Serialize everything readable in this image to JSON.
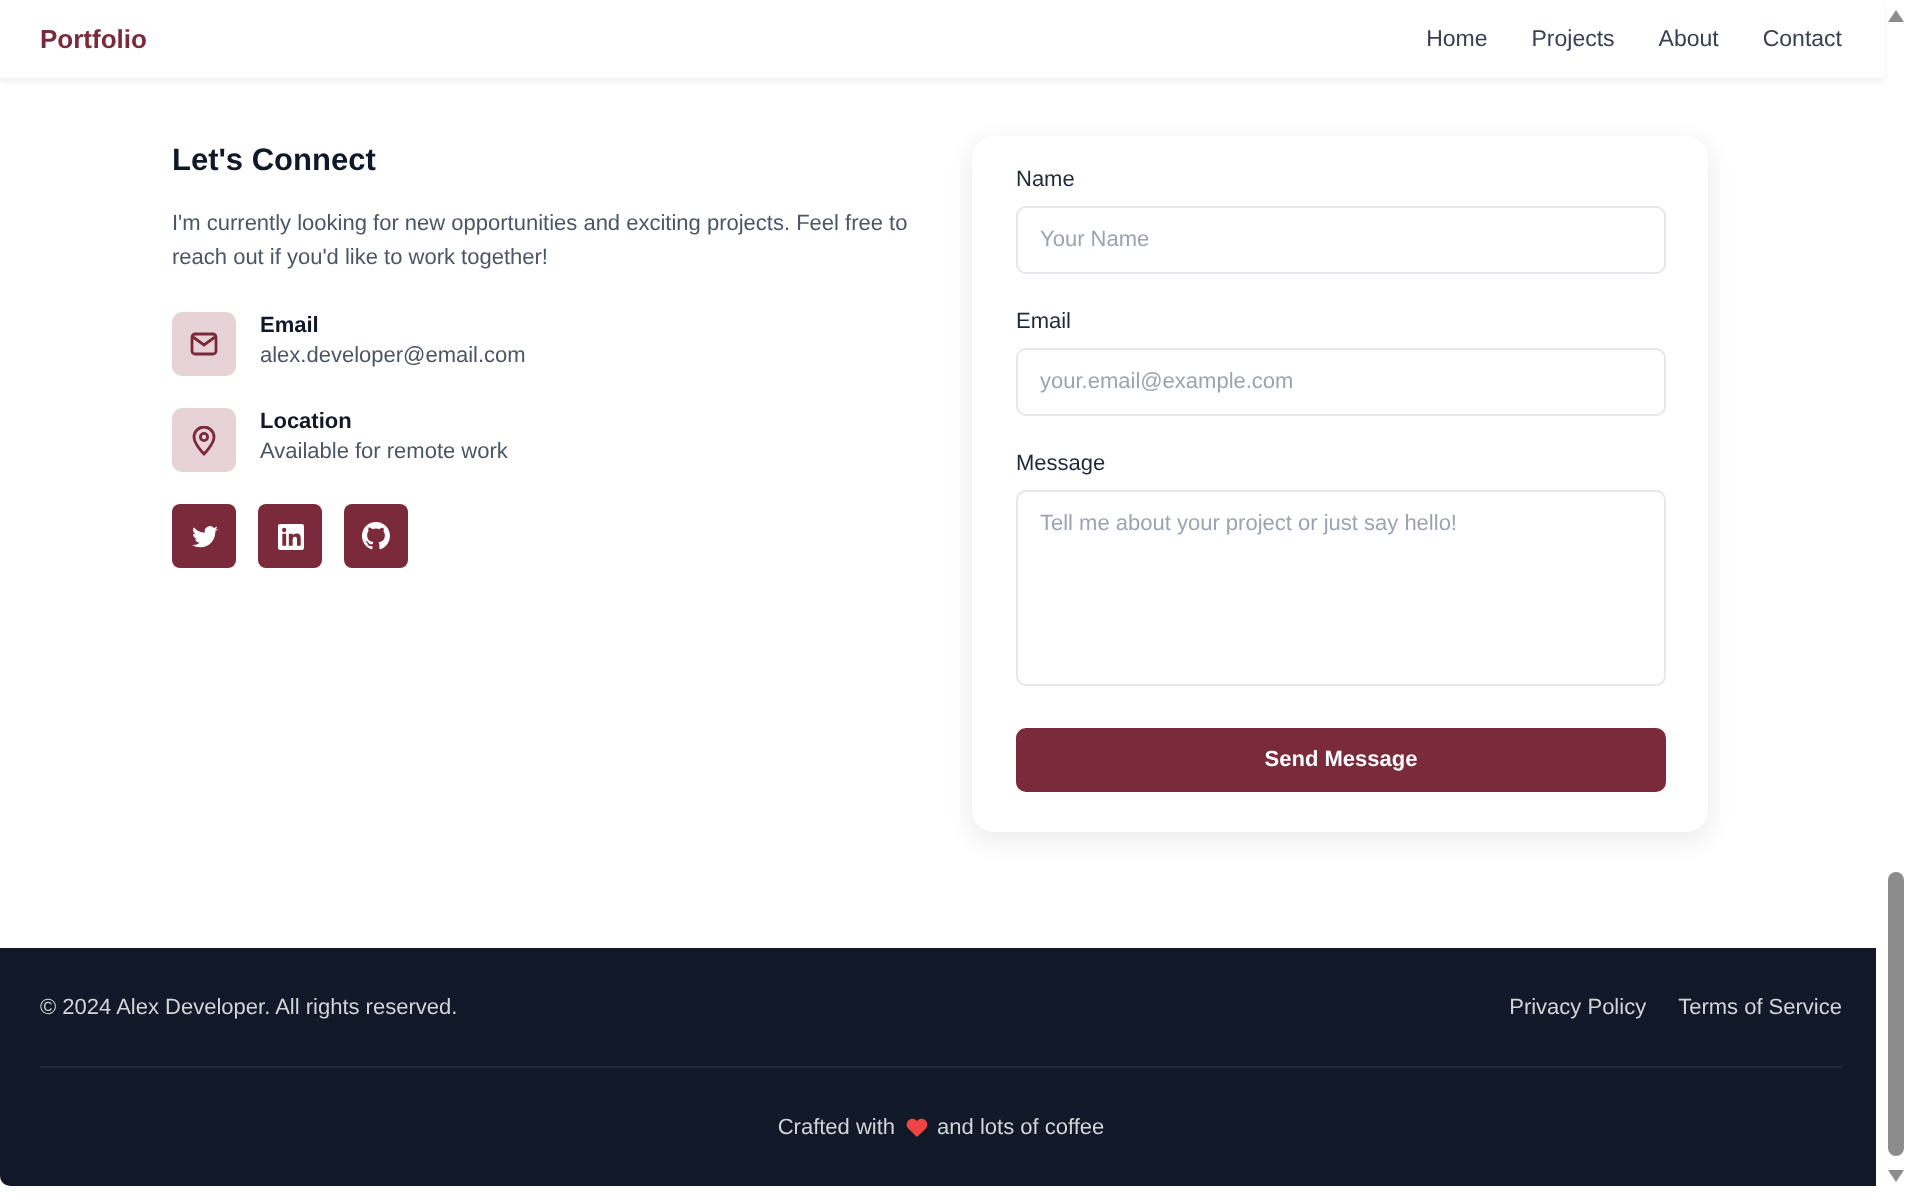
{
  "header": {
    "brand": "Portfolio",
    "nav": [
      {
        "label": "Home"
      },
      {
        "label": "Projects"
      },
      {
        "label": "About"
      },
      {
        "label": "Contact"
      }
    ]
  },
  "contact": {
    "title": "Let's Connect",
    "intro": "I'm currently looking for new opportunities and exciting projects. Feel free to reach out if you'd like to work together!",
    "items": [
      {
        "kind": "email",
        "label": "Email",
        "value": "alex.developer@email.com"
      },
      {
        "kind": "location",
        "label": "Location",
        "value": "Available for remote work"
      }
    ],
    "socials": [
      {
        "kind": "twitter"
      },
      {
        "kind": "linkedin"
      },
      {
        "kind": "github"
      }
    ]
  },
  "form": {
    "fields": [
      {
        "kind": "input",
        "label": "Name",
        "placeholder": "Your Name"
      },
      {
        "kind": "input",
        "label": "Email",
        "placeholder": "your.email@example.com"
      },
      {
        "kind": "textarea",
        "label": "Message",
        "placeholder": "Tell me about your project or just say hello!"
      }
    ],
    "submit": "Send Message"
  },
  "footer": {
    "copyright": "© 2024 Alex Developer. All rights reserved.",
    "links": [
      "Privacy Policy",
      "Terms of Service"
    ],
    "credit_before": "Crafted with",
    "credit_after": "and lots of coffee"
  }
}
